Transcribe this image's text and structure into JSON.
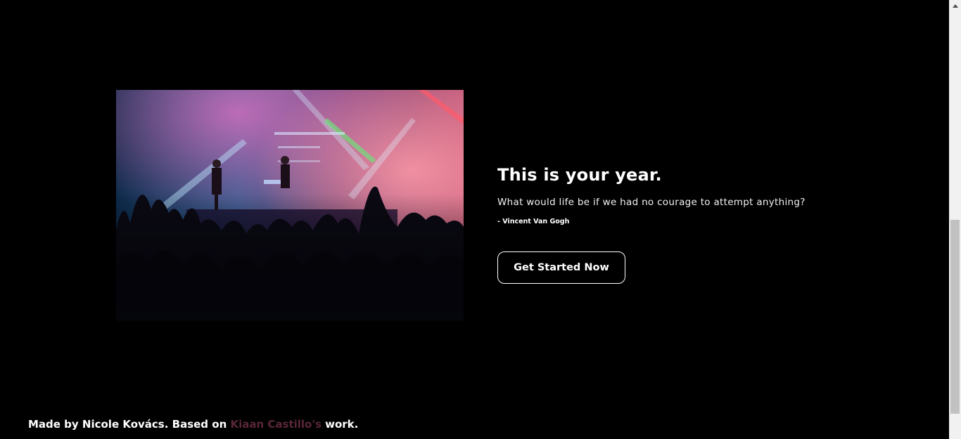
{
  "hero": {
    "image": {
      "description_icon": "concert-photo"
    },
    "title": "This is your year.",
    "quote": "What would life be if we had no courage to attempt anything?",
    "author": "- Vincent Van Gogh",
    "cta_label": "Get Started Now"
  },
  "footer": {
    "prefix": "Made by Nicole Kovács. Based on ",
    "link_text": "Kiaan Castillo's",
    "suffix": " work."
  },
  "colors": {
    "background": "#000000",
    "text": "#ffffff",
    "link": "#5a2737"
  }
}
